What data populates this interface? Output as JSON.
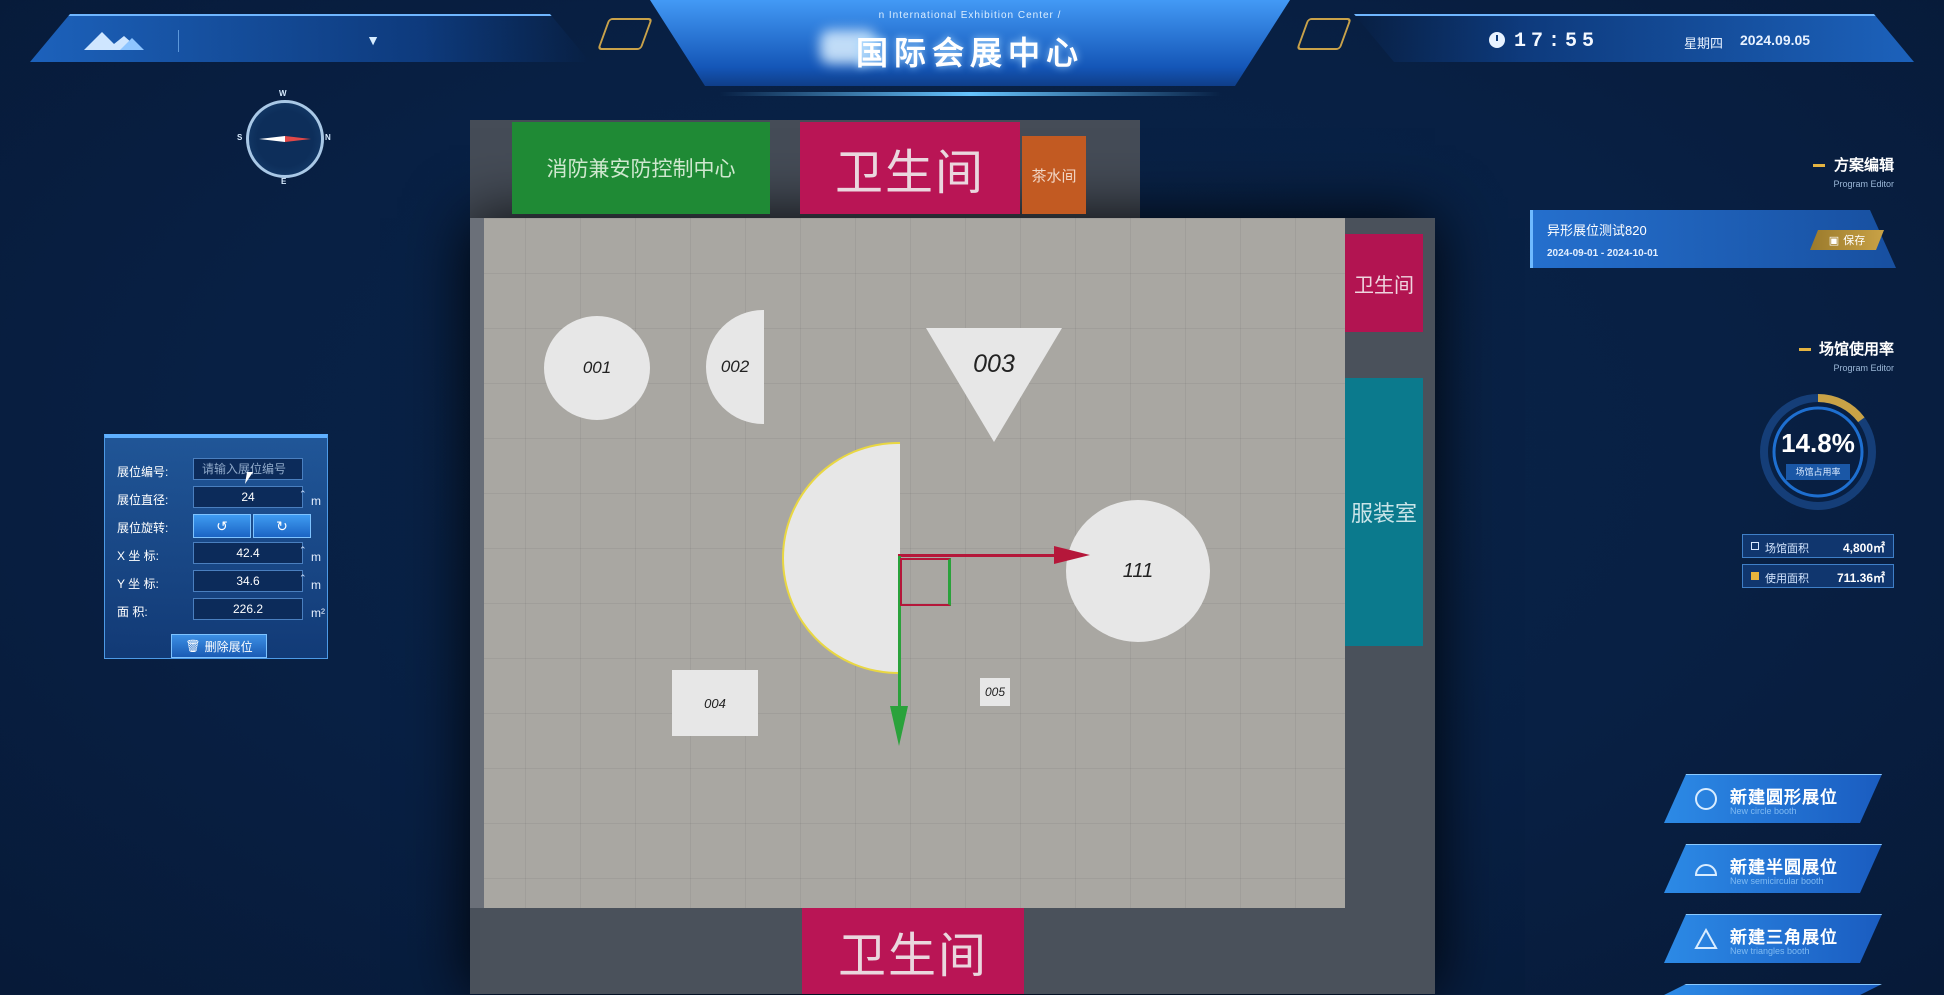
{
  "header": {
    "subtitle_en": "n International Exhibition Center /",
    "title_cn": "国际会展中心",
    "time": "17:55",
    "weekday": "星期四",
    "date": "2024.09.05"
  },
  "compass": {
    "w": "W",
    "s": "S",
    "n": "N",
    "e": "E"
  },
  "rooms": {
    "fire_control": "消防兼安防控制中心",
    "restroom_top": "卫生间",
    "tea_room": "茶水间",
    "restroom_right": "卫生间",
    "costume_room": "服装室",
    "restroom_bottom": "卫生间"
  },
  "booths": {
    "b001": "001",
    "b002": "002",
    "b003": "003",
    "b004": "004",
    "b005": "005",
    "b111": "111"
  },
  "properties": {
    "booth_no_label": "展位编号:",
    "booth_no_placeholder": "请输入展位编号",
    "diameter_label": "展位直径:",
    "diameter_value": "24",
    "diameter_unit": "m",
    "rotation_label": "展位旋转:",
    "x_label": "X 坐 标:",
    "x_value": "42.4",
    "x_unit": "m",
    "y_label": "Y 坐 标:",
    "y_value": "34.6",
    "y_unit": "m",
    "area_label": "面    积:",
    "area_value": "226.2",
    "area_unit": "m²",
    "delete_label": "删除展位"
  },
  "plan": {
    "section_title": "方案编辑",
    "section_sub": "Program Editor",
    "name": "异形展位测试820",
    "range": "2024-09-01 - 2024-10-01",
    "save_label": "保存"
  },
  "usage": {
    "section_title": "场馆使用率",
    "section_sub": "Program Editor",
    "rate": "14.8%",
    "rate_value": 0.148,
    "rate_caption": "场馆占用率",
    "venue_area_label": "场馆面积",
    "venue_area_value": "4,800㎡",
    "used_area_label": "使用面积",
    "used_area_value": "711.36㎡"
  },
  "create": [
    {
      "title": "新建圆形展位",
      "sub": "New circle booth"
    },
    {
      "title": "新建半圆展位",
      "sub": "New semicircular booth"
    },
    {
      "title": "新建三角展位",
      "sub": "New triangles booth"
    }
  ],
  "colors": {
    "accent": "#2c8ae6",
    "gold": "#e4b341",
    "restroom": "#b91555",
    "fire_room": "#1f8a35",
    "costume_room": "#0b7a8d"
  }
}
